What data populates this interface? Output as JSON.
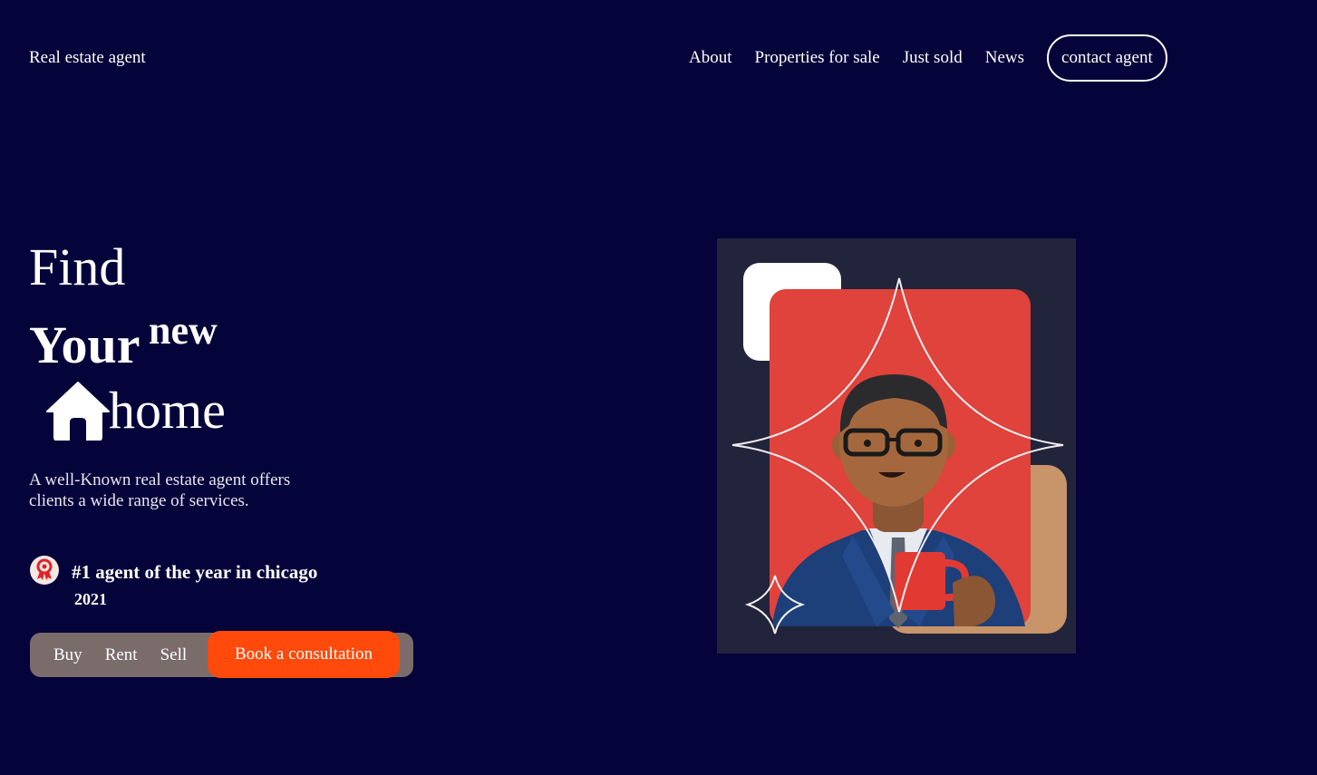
{
  "header": {
    "brand": "Real estate agent",
    "nav": [
      "About",
      "Properties for sale",
      "Just sold",
      "News"
    ],
    "contact_button": "contact agent"
  },
  "hero": {
    "line1": "Find",
    "line2": "Your",
    "superscript": "new",
    "line3": "home",
    "description": "A well-Known real estate agent offers clients a wide range of services."
  },
  "award": {
    "title": "#1 agent of the year in chicago",
    "year": "2021"
  },
  "actions": {
    "buy": "Buy",
    "rent": "Rent",
    "sell": "Sell",
    "book": "Book a consultation"
  },
  "icons": {
    "house": "house-icon",
    "award": "award-badge-icon",
    "agent": "agent-avatar-illustration"
  },
  "colors": {
    "background": "#04033a",
    "accent": "#ff4a0c",
    "pill": "#7b6c6c",
    "card_red": "#e0423c",
    "card_tan": "#c8946a"
  }
}
